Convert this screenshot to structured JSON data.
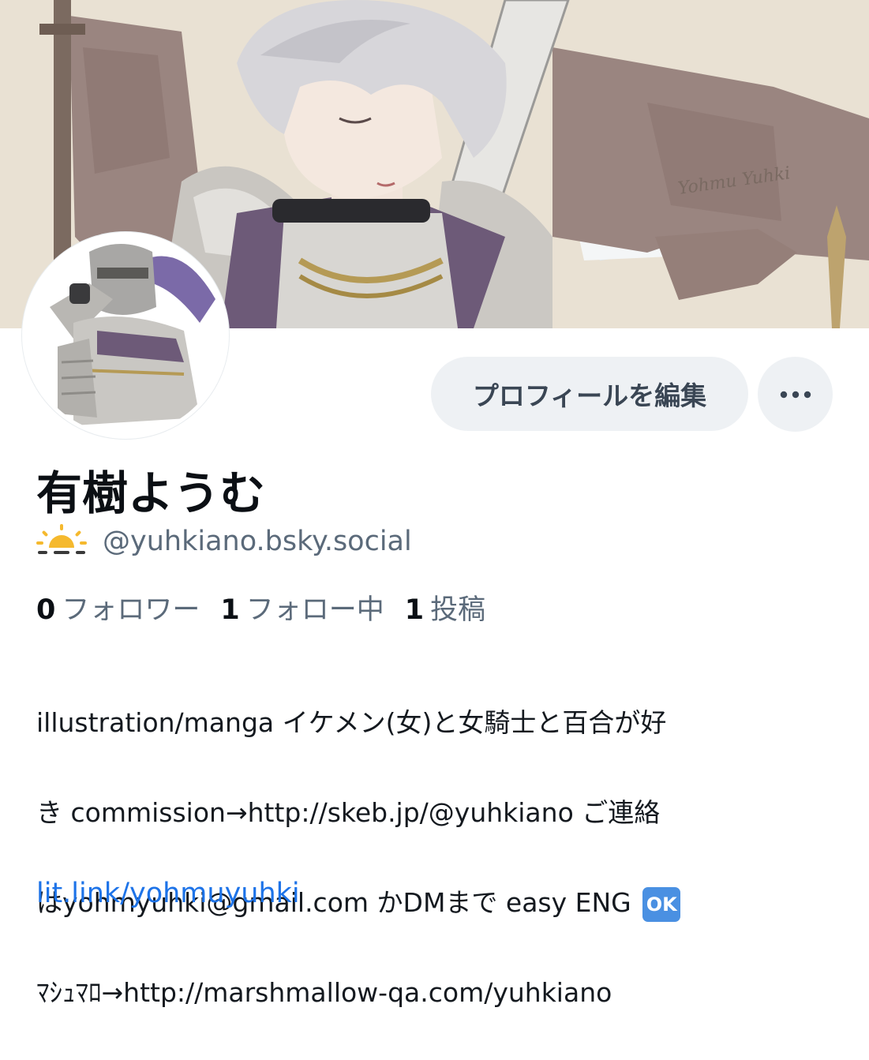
{
  "profile": {
    "display_name": "有樹ようむ",
    "handle": "@yuhkiano.bsky.social",
    "handle_icon": "sun-behind-horizon-icon",
    "edit_button_label": "プロフィールを編集",
    "more_button_icon": "ellipsis-icon",
    "stats": [
      {
        "count": "0",
        "label": "フォロワー"
      },
      {
        "count": "1",
        "label": "フォロー中"
      },
      {
        "count": "1",
        "label": "投稿"
      }
    ],
    "bio": {
      "line1": "illustration/manga イケメン(女)と女騎士と百合が好",
      "line2": "き commission→http://skeb.jp/@yuhkiano ご連絡",
      "line3": "はyohmyuhki@gmail.com かDMまで easy ENG",
      "ok_badge": "OK",
      "line4": "ﾏｼｭﾏﾛ→http://marshmallow-qa.com/yuhkiano"
    },
    "link": "lit.link/yohmuyuhki",
    "banner_signature": "Yohmu Yuhki",
    "colors": {
      "link": "#1d73e8",
      "button_bg": "#eef1f4",
      "muted_text": "#5b6a7a",
      "ok_badge": "#4a90e2"
    }
  }
}
